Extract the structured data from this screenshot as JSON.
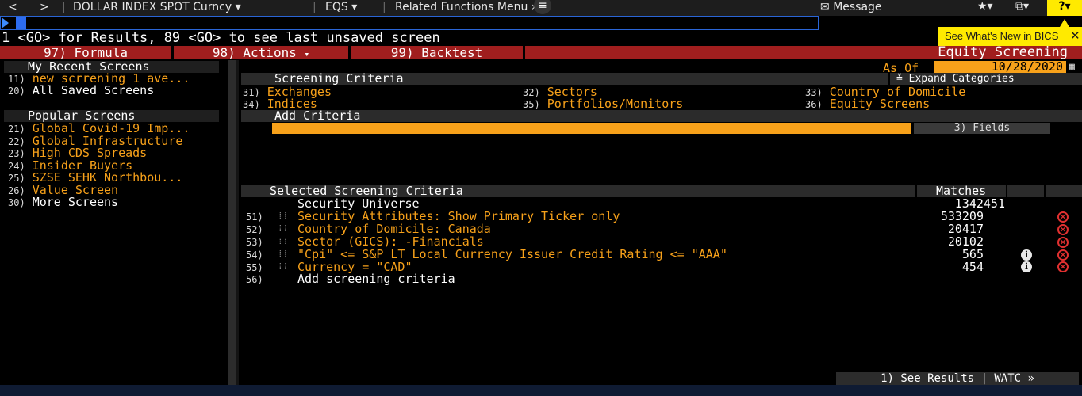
{
  "topbar": {
    "back": "<",
    "forward": ">",
    "security": "DOLLAR INDEX SPOT Curncy",
    "function": "EQS",
    "related": "Related Functions Menu",
    "message": "Message",
    "help": "?"
  },
  "command_hint": "1 <GO> for Results, 89 <GO> to see last unsaved screen",
  "whats_new": "See What's New in BICS",
  "menu": {
    "formula": "97) Formula",
    "actions": "98) Actions",
    "backtest": "99) Backtest",
    "title": "Equity Screening"
  },
  "left": {
    "recent_header": "My Recent Screens",
    "recent": [
      {
        "num": "11)",
        "label": "new scrrening 1 ave..."
      },
      {
        "num": "20)",
        "label": "All Saved Screens"
      }
    ],
    "popular_header": "Popular Screens",
    "popular": [
      {
        "num": "21)",
        "label": "Global Covid-19 Imp..."
      },
      {
        "num": "22)",
        "label": "Global Infrastructure"
      },
      {
        "num": "23)",
        "label": "High CDS Spreads"
      },
      {
        "num": "24)",
        "label": "Insider Buyers"
      },
      {
        "num": "25)",
        "label": "SZSE SEHK Northbou..."
      },
      {
        "num": "26)",
        "label": "Value Screen"
      },
      {
        "num": "30)",
        "label": "More Screens"
      }
    ]
  },
  "asof": {
    "label": "As Of",
    "date": "10/28/2020"
  },
  "screening": {
    "header": "Screening Criteria",
    "expand": "Expand Categories",
    "categories": [
      {
        "num": "31)",
        "label": "Exchanges"
      },
      {
        "num": "32)",
        "label": "Sectors"
      },
      {
        "num": "33)",
        "label": "Country of Domicile"
      },
      {
        "num": "34)",
        "label": "Indices"
      },
      {
        "num": "35)",
        "label": "Portfolios/Monitors"
      },
      {
        "num": "36)",
        "label": "Equity Screens"
      }
    ]
  },
  "add_criteria": {
    "header": "Add Criteria",
    "input_value": "",
    "fields": "3) Fields"
  },
  "selected": {
    "header": "Selected Screening Criteria",
    "matches_header": "Matches",
    "universe_label": "Security Universe",
    "universe_value": "1342451",
    "rows": [
      {
        "num": "51)",
        "label": "Security Attributes: Show Primary Ticker only",
        "matches": "533209"
      },
      {
        "num": "52)",
        "label": "Country of Domicile: Canada",
        "matches": "20417"
      },
      {
        "num": "53)",
        "label": "Sector (GICS): -Financials",
        "matches": "20102"
      },
      {
        "num": "54)",
        "label": "\"Cpi\" <= S&P LT Local Currency Issuer Credit Rating <= \"AAA\"",
        "matches": "565"
      },
      {
        "num": "55)",
        "label": "Currency = \"CAD\"",
        "matches": "454"
      }
    ],
    "add_num": "56)",
    "add_label": "Add screening criteria"
  },
  "see_results": "1) See Results | WATC »",
  "colors": {
    "accent": "#f7a11a",
    "menu_red": "#a01e1e",
    "highlight": "#ffea00"
  }
}
